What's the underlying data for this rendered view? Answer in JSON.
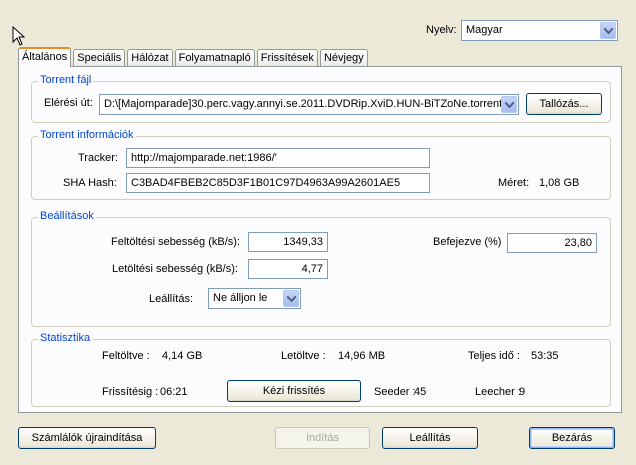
{
  "language": {
    "label": "Nyelv:",
    "value": "Magyar"
  },
  "tabs": [
    {
      "label": "Általános",
      "active": true
    },
    {
      "label": "Speciális"
    },
    {
      "label": "Hálózat"
    },
    {
      "label": "Folyamatnapló"
    },
    {
      "label": "Frissítések"
    },
    {
      "label": "Névjegy"
    }
  ],
  "torrent_file": {
    "title": "Torrent fájl",
    "path_label": "Elérési út:",
    "path_value": "D:\\[Majomparade]30.perc.vagy.annyi.se.2011.DVDRip.XviD.HUN-BiTZoNe.torrent",
    "browse_label": "Tallózás..."
  },
  "torrent_info": {
    "title": "Torrent információk",
    "tracker_label": "Tracker:",
    "tracker_value": "http://majomparade.net:1986/'",
    "hash_label": "SHA Hash:",
    "hash_value": "C3BAD4FBEB2C85D3F1B01C97D4963A99A2601AE5",
    "size_label": "Méret:",
    "size_value": "1,08 GB"
  },
  "settings": {
    "title": "Beállítások",
    "upload_speed_label": "Feltöltési sebesség (kB/s):",
    "upload_speed_value": "1349,33",
    "download_speed_label": "Letöltési sebesség (kB/s):",
    "download_speed_value": "4,77",
    "completed_label": "Befejezve (%)",
    "completed_value": "23,80",
    "stop_label": "Leállítás:",
    "stop_value": "Ne álljon le"
  },
  "stats": {
    "title": "Statisztika",
    "uploaded_label": "Feltöltve :",
    "uploaded_value": "4,14 GB",
    "downloaded_label": "Letöltve :",
    "downloaded_value": "14,96 MB",
    "total_time_label": "Teljes idő :",
    "total_time_value": "53:35",
    "refresh_label": "Frissítésig :",
    "refresh_value": "06:21",
    "manual_refresh_label": "Kézi frissítés",
    "seeder_label": "Seeder :",
    "seeder_value": "45",
    "leecher_label": "Leecher :",
    "leecher_value": "9"
  },
  "footer": {
    "reset_label": "Számlálók újraindítása",
    "start_label": "Indítás",
    "stop_label": "Leállítás",
    "close_label": "Bezárás"
  }
}
